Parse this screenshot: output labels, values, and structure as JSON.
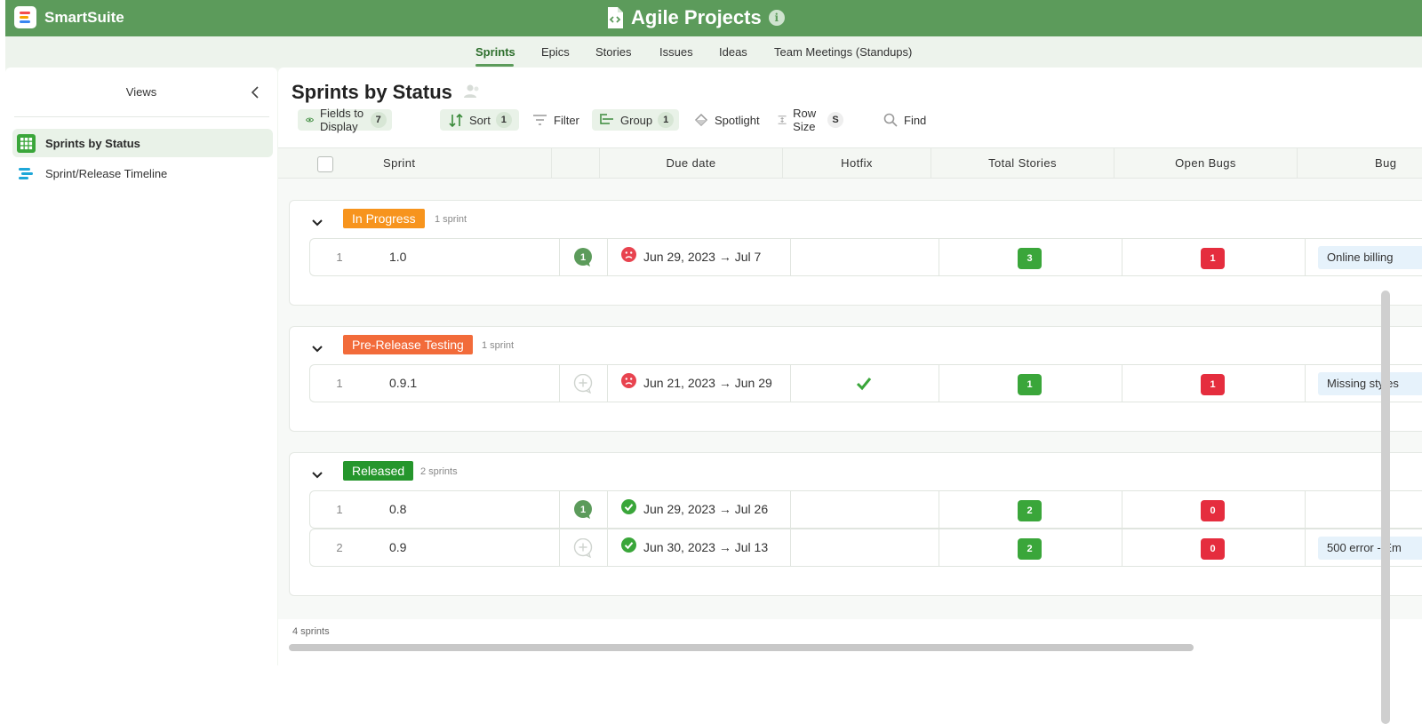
{
  "app": {
    "brand": "SmartSuite",
    "title": "Agile Projects",
    "info_icon": "i"
  },
  "tabs": [
    {
      "label": "Sprints",
      "active": true
    },
    {
      "label": "Epics"
    },
    {
      "label": "Stories"
    },
    {
      "label": "Issues"
    },
    {
      "label": "Ideas"
    },
    {
      "label": "Team Meetings (Standups)"
    }
  ],
  "views": {
    "title": "Views",
    "items": [
      {
        "label": "Sprints by Status",
        "icon": "grid-view-icon",
        "active": true
      },
      {
        "label": "Sprint/Release Timeline",
        "icon": "timeline-view-icon"
      }
    ]
  },
  "main": {
    "title": "Sprints by Status",
    "toolbar": {
      "fields": {
        "label": "Fields to Display",
        "count": "7"
      },
      "sort": {
        "label": "Sort",
        "count": "1"
      },
      "filter": {
        "label": "Filter"
      },
      "group": {
        "label": "Group",
        "count": "1"
      },
      "spotlight": {
        "label": "Spotlight"
      },
      "rowsize": {
        "label": "Row Size",
        "count": "S"
      },
      "find": {
        "label": "Find"
      }
    },
    "columns": [
      "Sprint",
      "",
      "Due date",
      "Hotfix",
      "Total Stories",
      "Open Bugs",
      "Bug"
    ],
    "groups": [
      {
        "label": "In Progress",
        "color": "#f7941d",
        "count": "1 sprint",
        "rows": [
          {
            "num": "1",
            "name": "1.0",
            "comments": "1",
            "due": "Jun 29, 2023",
            "due_end": "Jul 7",
            "status": "overdue",
            "hotfix": false,
            "total_stories": "3",
            "open_bugs": "1",
            "bug": "Online billing"
          }
        ]
      },
      {
        "label": "Pre-Release Testing",
        "color": "#f26b3a",
        "count": "1 sprint",
        "rows": [
          {
            "num": "1",
            "name": "0.9.1",
            "comments": "",
            "due": "Jun 21, 2023",
            "due_end": "Jun 29",
            "status": "overdue",
            "hotfix": true,
            "total_stories": "1",
            "open_bugs": "1",
            "bug": "Missing styles"
          }
        ]
      },
      {
        "label": "Released",
        "color": "#25962c",
        "count": "2 sprints",
        "rows": [
          {
            "num": "1",
            "name": "0.8",
            "comments": "1",
            "due": "Jun 29, 2023",
            "due_end": "Jul 26",
            "status": "done",
            "hotfix": false,
            "total_stories": "2",
            "open_bugs": "0",
            "bug": ""
          },
          {
            "num": "2",
            "name": "0.9",
            "comments": "",
            "due": "Jun 30, 2023",
            "due_end": "Jul 13",
            "status": "done",
            "hotfix": false,
            "total_stories": "2",
            "open_bugs": "0",
            "bug": "500 error - Em"
          }
        ]
      }
    ],
    "footer": "4 sprints",
    "arrow": "→"
  }
}
